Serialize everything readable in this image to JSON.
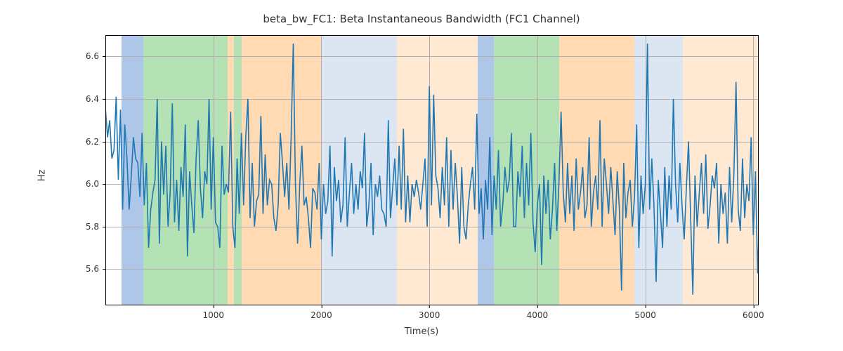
{
  "chart_data": {
    "type": "line",
    "title": "beta_bw_FC1: Beta Instantaneous Bandwidth (FC1 Channel)",
    "xlabel": "Time(s)",
    "ylabel": "Hz",
    "xlim": [
      0,
      6050
    ],
    "ylim": [
      5.43,
      6.7
    ],
    "xticks": [
      1000,
      2000,
      3000,
      4000,
      5000,
      6000
    ],
    "yticks": [
      5.6,
      5.8,
      6.0,
      6.2,
      6.4,
      6.6
    ],
    "background_spans": [
      {
        "x0": 150,
        "x1": 350,
        "color": "#aec7e8"
      },
      {
        "x0": 350,
        "x1": 1130,
        "color": "#b4e2b4"
      },
      {
        "x0": 1130,
        "x1": 1190,
        "color": "#ffdab3"
      },
      {
        "x0": 1190,
        "x1": 1260,
        "color": "#b4e2b4"
      },
      {
        "x0": 1260,
        "x1": 2000,
        "color": "#ffdab3"
      },
      {
        "x0": 2000,
        "x1": 2700,
        "color": "#dbe6f2"
      },
      {
        "x0": 2700,
        "x1": 3450,
        "color": "#ffe9d3"
      },
      {
        "x0": 3450,
        "x1": 3600,
        "color": "#aec7e8"
      },
      {
        "x0": 3600,
        "x1": 4200,
        "color": "#b4e2b4"
      },
      {
        "x0": 4200,
        "x1": 4900,
        "color": "#ffdab3"
      },
      {
        "x0": 4900,
        "x1": 5350,
        "color": "#dbe6f2"
      },
      {
        "x0": 5350,
        "x1": 6050,
        "color": "#ffe9d3"
      }
    ],
    "series": [
      {
        "name": "beta_bw_FC1",
        "color": "#1f77b4",
        "x_start": 0,
        "x_step": 20,
        "y": [
          6.36,
          6.22,
          6.3,
          6.12,
          6.16,
          6.41,
          6.02,
          6.35,
          5.88,
          6.28,
          6.12,
          5.88,
          6.04,
          6.22,
          6.12,
          6.1,
          5.94,
          6.24,
          5.9,
          6.1,
          5.7,
          5.88,
          5.96,
          6.02,
          6.4,
          5.72,
          6.2,
          5.95,
          6.18,
          5.8,
          5.96,
          6.38,
          5.82,
          6.02,
          5.78,
          6.08,
          5.94,
          6.28,
          5.66,
          6.06,
          5.9,
          5.77,
          6.12,
          6.3,
          5.98,
          5.84,
          6.06,
          6.0,
          6.4,
          5.88,
          6.22,
          5.82,
          5.8,
          5.7,
          6.18,
          5.95,
          6.0,
          5.96,
          6.34,
          5.8,
          5.7,
          6.12,
          5.86,
          6.24,
          5.9,
          6.22,
          6.4,
          5.84,
          6.1,
          5.8,
          5.92,
          5.95,
          6.32,
          5.86,
          6.14,
          5.9,
          6.02,
          6.0,
          5.84,
          5.78,
          5.9,
          6.24,
          6.1,
          5.94,
          6.1,
          5.88,
          6.22,
          6.66,
          6.0,
          5.72,
          6.0,
          6.18,
          5.9,
          5.94,
          5.84,
          5.7,
          5.98,
          5.96,
          5.88,
          6.1,
          5.74,
          6.0,
          5.86,
          5.92,
          6.18,
          5.66,
          6.08,
          5.92,
          6.02,
          5.82,
          5.9,
          6.22,
          5.8,
          5.96,
          6.1,
          5.86,
          6.0,
          5.88,
          6.06,
          5.98,
          6.24,
          5.8,
          5.9,
          6.1,
          5.76,
          6.0,
          5.94,
          6.04,
          5.88,
          5.86,
          5.8,
          6.3,
          5.84,
          5.98,
          6.12,
          5.9,
          6.18,
          5.88,
          6.26,
          5.82,
          6.04,
          5.82,
          6.0,
          5.94,
          6.02,
          5.96,
          5.88,
          6.0,
          6.12,
          5.8,
          6.46,
          5.9,
          6.42,
          6.04,
          5.98,
          5.84,
          6.08,
          5.9,
          6.22,
          5.8,
          6.16,
          5.88,
          6.1,
          5.94,
          5.72,
          6.08,
          5.8,
          5.74,
          5.9,
          6.0,
          6.08,
          5.88,
          6.33,
          5.86,
          5.98,
          5.74,
          6.02,
          5.88,
          6.22,
          5.76,
          6.04,
          5.88,
          6.16,
          5.8,
          5.9,
          6.08,
          5.96,
          6.02,
          6.24,
          5.8,
          5.8,
          6.06,
          5.94,
          6.18,
          5.84,
          6.1,
          5.9,
          6.24,
          5.82,
          5.68,
          5.9,
          6.0,
          5.62,
          6.04,
          5.86,
          6.02,
          5.74,
          5.88,
          6.1,
          5.78,
          6.0,
          6.34,
          5.96,
          5.82,
          6.1,
          5.86,
          6.04,
          5.78,
          6.12,
          5.88,
          5.96,
          6.08,
          5.84,
          5.9,
          6.22,
          5.8,
          5.96,
          6.04,
          5.88,
          6.3,
          5.8,
          6.12,
          6.0,
          5.86,
          6.08,
          5.92,
          5.76,
          6.06,
          5.88,
          5.5,
          6.1,
          5.84,
          5.96,
          6.02,
          5.8,
          5.94,
          6.28,
          5.7,
          6.04,
          5.86,
          6.0,
          6.66,
          5.88,
          6.12,
          5.9,
          5.54,
          6.02,
          5.86,
          5.7,
          6.08,
          5.8,
          6.04,
          5.88,
          6.4,
          6.0,
          5.82,
          6.1,
          5.9,
          5.74,
          5.98,
          6.2,
          5.84,
          5.48,
          6.04,
          5.8,
          5.96,
          6.1,
          5.86,
          6.14,
          5.79,
          5.9,
          6.04,
          5.98,
          6.1,
          5.72,
          6.0,
          5.86,
          5.96,
          5.72,
          6.08,
          5.82,
          6.04,
          6.48,
          5.88,
          5.78,
          6.12,
          5.84,
          6.0,
          5.92,
          6.22,
          5.76,
          6.06,
          5.58,
          5.9
        ]
      }
    ]
  }
}
